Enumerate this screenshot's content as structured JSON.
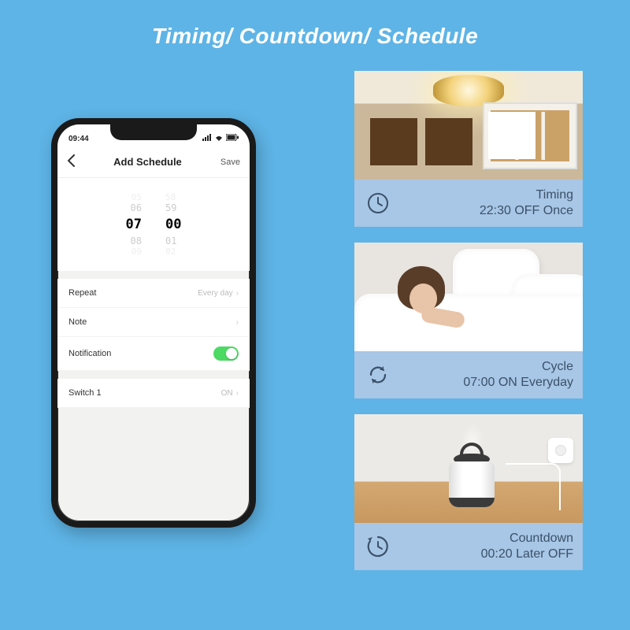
{
  "main_title": "Timing/ Countdown/ Schedule",
  "phone": {
    "status_time": "09:44",
    "nav_title": "Add Schedule",
    "nav_save": "Save",
    "picker": {
      "hm3": {
        "h": "05",
        "m": "58"
      },
      "hm2": {
        "h": "06",
        "m": "59"
      },
      "sel": {
        "h": "07",
        "m": "00"
      },
      "hp2": {
        "h": "08",
        "m": "01"
      },
      "hp3": {
        "h": "09",
        "m": "02"
      }
    },
    "rows": {
      "repeat_label": "Repeat",
      "repeat_value": "Every day",
      "note_label": "Note",
      "notification_label": "Notification",
      "switch_label": "Switch 1",
      "switch_value": "ON"
    }
  },
  "cards": [
    {
      "title": "Timing",
      "subtitle": "22:30 OFF Once"
    },
    {
      "title": "Cycle",
      "subtitle": "07:00 ON Everyday"
    },
    {
      "title": "Countdown",
      "subtitle": "00:20 Later OFF"
    }
  ]
}
